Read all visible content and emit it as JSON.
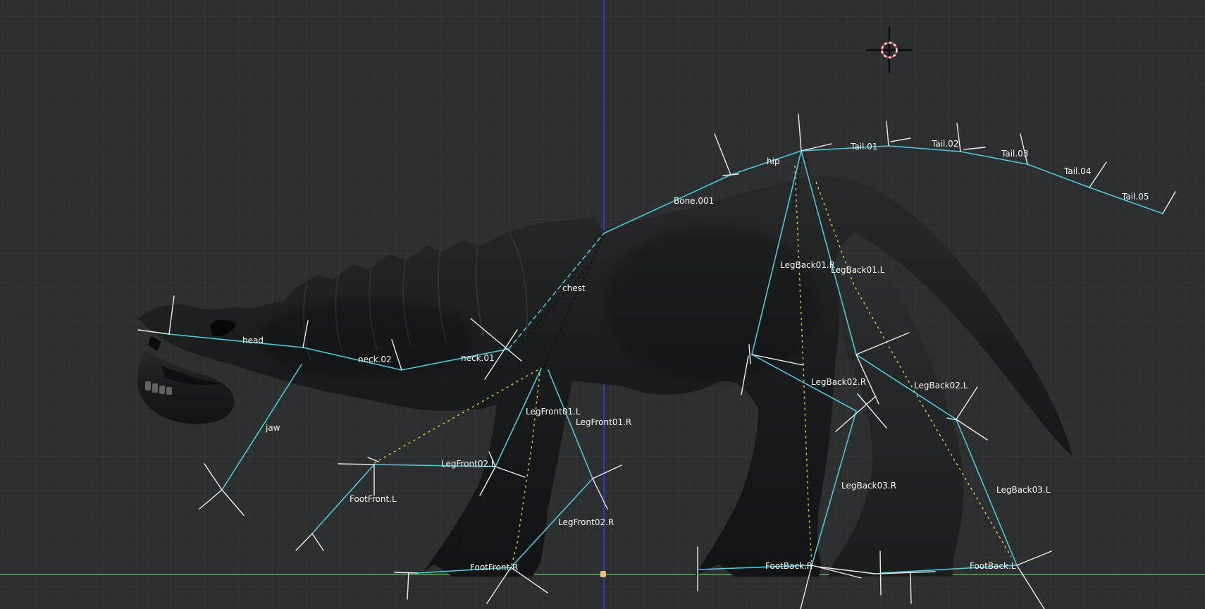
{
  "app": "blender-3d-viewport",
  "viewport": {
    "view": "orthographic-side",
    "colors": {
      "background": "#2c2e2f",
      "grid_minor": "#313334",
      "grid_major": "#383a3c",
      "axis_z_blue": "#3038c8",
      "axis_y_green": "#44a23f",
      "bone_wire_cyan": "#4cc8d8",
      "bone_name_text": "#f5f5f5",
      "ik_relation_yellow": "#d9d93a",
      "parent_relation_black": "#0e0e0e",
      "bone_axes_white": "#ececec",
      "mesh_dark": "#17191a",
      "mesh_light": "#27292b",
      "cursor_red": "#cc3b3b",
      "cursor_white": "#f2f2f2",
      "origin_point_orange": "#e7bd78"
    },
    "icons": [
      "3d-cursor-icon",
      "origin-point-icon"
    ]
  },
  "bones": [
    {
      "label": "head"
    },
    {
      "label": "jaw"
    },
    {
      "label": "neck.02"
    },
    {
      "label": "neck.01"
    },
    {
      "label": "chest"
    },
    {
      "label": "Bone.001"
    },
    {
      "label": "hip"
    },
    {
      "label": "Tail.01"
    },
    {
      "label": "Tail.02"
    },
    {
      "label": "Tail.03"
    },
    {
      "label": "Tail.04"
    },
    {
      "label": "Tail.05"
    },
    {
      "label": "LegBack01.R"
    },
    {
      "label": "LegBack01.L"
    },
    {
      "label": "LegBack02.R"
    },
    {
      "label": "LegBack02.L"
    },
    {
      "label": "LegBack03.R"
    },
    {
      "label": "LegBack03.L"
    },
    {
      "label": "FootBack.R"
    },
    {
      "label": "FootBack.L"
    },
    {
      "label": "LegFront01.L"
    },
    {
      "label": "LegFront01.R"
    },
    {
      "label": "LegFront02.L"
    },
    {
      "label": "LegFront02.R"
    },
    {
      "label": "FootFront.L"
    },
    {
      "label": "FootFront.R"
    }
  ]
}
